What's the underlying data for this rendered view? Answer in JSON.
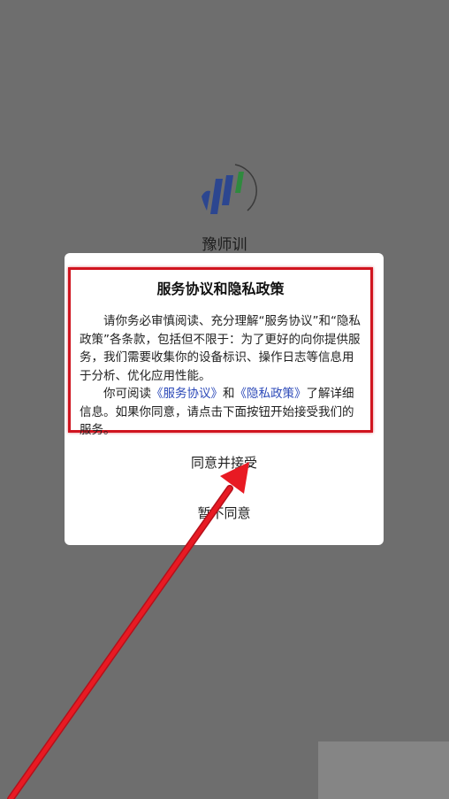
{
  "app": {
    "name": "豫师训",
    "logo_icon": "app-logo-icon"
  },
  "dialog": {
    "title": "服务协议和隐私政策",
    "paragraph1": "请你务必审慎阅读、充分理解“服务协议”和“隐私政策”各条款，包括但不限于：为了更好的向你提供服务，我们需要收集你的设备标识、操作日志等信息用于分析、优化应用性能。",
    "paragraph2_prefix": "你可阅读",
    "service_link": "《服务协议》",
    "and_text": "和",
    "privacy_link": "《隐私政策》",
    "paragraph2_suffix": "了解详细信息。如果你同意，请点击下面按钮开始接受我们的服务。",
    "agree_button": "同意并接受",
    "disagree_button": "暂不同意"
  },
  "colors": {
    "background": "#6e6e6e",
    "highlight_border": "#d0141f",
    "link": "#2c49b8",
    "logo_blue": "#2c4690"
  }
}
